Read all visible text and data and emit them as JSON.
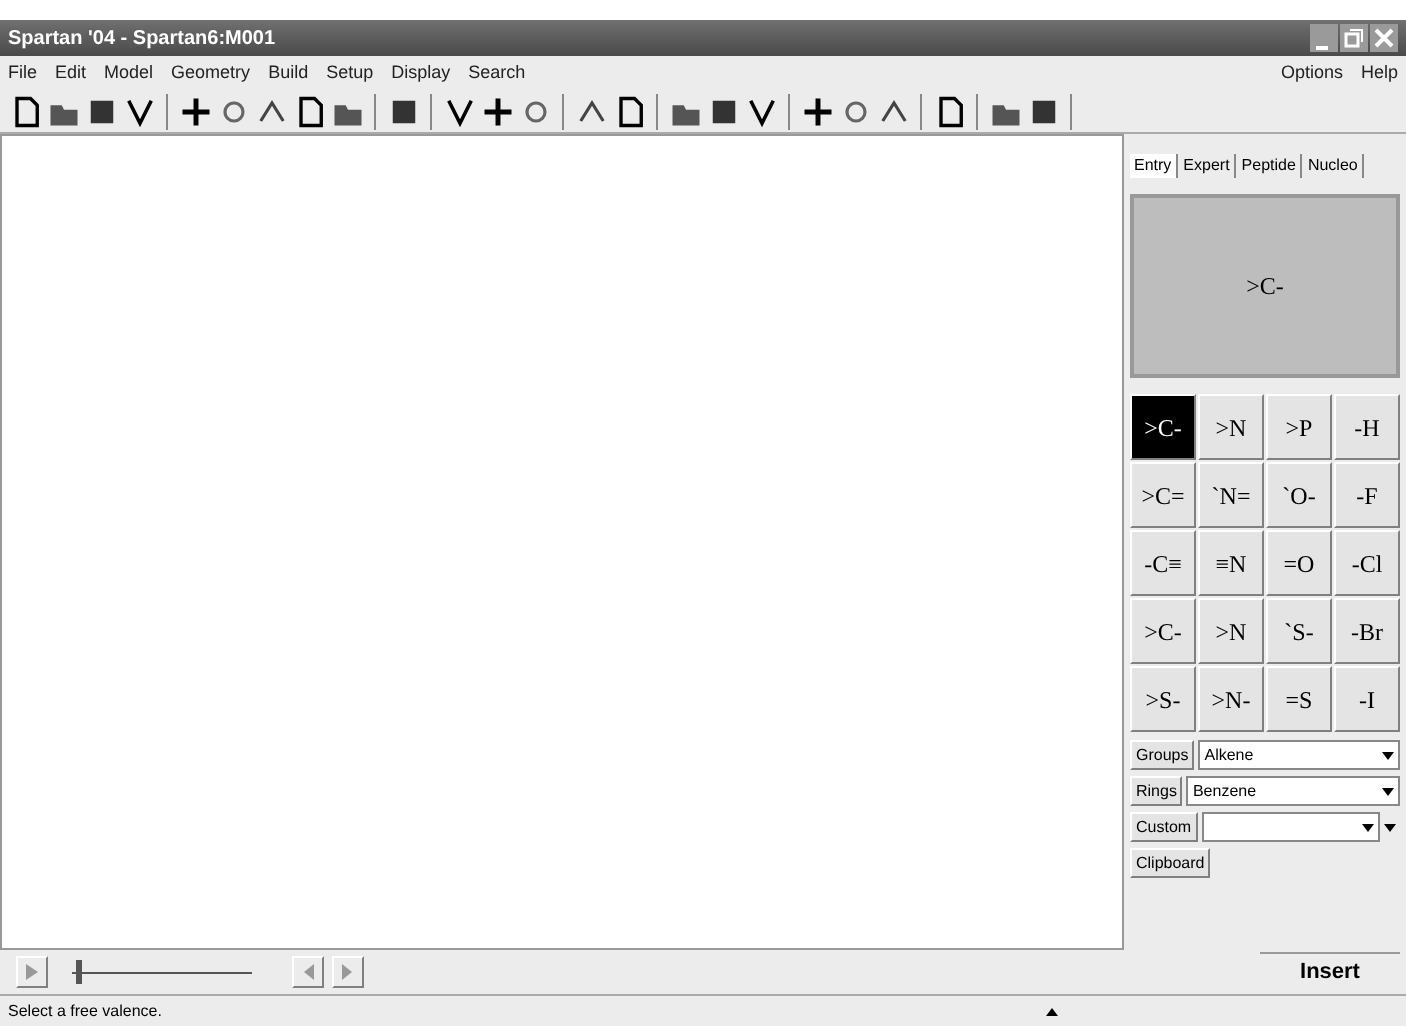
{
  "window": {
    "title": "Spartan '04 - Spartan6:M001"
  },
  "menu": {
    "left": [
      "File",
      "Edit",
      "Model",
      "Geometry",
      "Build",
      "Setup",
      "Display",
      "Search"
    ],
    "right": [
      "Options",
      "Help"
    ]
  },
  "panel": {
    "tabs": [
      {
        "label": "Entry",
        "selected": true
      },
      {
        "label": "Expert",
        "selected": false
      },
      {
        "label": "Peptide",
        "selected": false
      },
      {
        "label": "Nucleo",
        "selected": false
      }
    ],
    "preview": ">C-",
    "fragments": [
      {
        "label": ">C-",
        "selected": true
      },
      {
        "label": ">N",
        "selected": false
      },
      {
        "label": ">P",
        "selected": false
      },
      {
        "label": "-H",
        "selected": false
      },
      {
        "label": ">C=",
        "selected": false
      },
      {
        "label": "`N=",
        "selected": false
      },
      {
        "label": "`O-",
        "selected": false
      },
      {
        "label": "-F",
        "selected": false
      },
      {
        "label": "-C≡",
        "selected": false
      },
      {
        "label": "≡N",
        "selected": false
      },
      {
        "label": "=O",
        "selected": false
      },
      {
        "label": "-Cl",
        "selected": false
      },
      {
        "label": ">C-",
        "selected": false
      },
      {
        "label": ">N",
        "selected": false
      },
      {
        "label": "`S-",
        "selected": false
      },
      {
        "label": "-Br",
        "selected": false
      },
      {
        "label": ">S-",
        "selected": false
      },
      {
        "label": ">N-",
        "selected": false
      },
      {
        "label": "=S",
        "selected": false
      },
      {
        "label": "-I",
        "selected": false
      }
    ],
    "libraries": [
      {
        "kind": "preset",
        "button": "Groups",
        "value": "Alkene"
      },
      {
        "kind": "preset",
        "button": "Rings",
        "value": "Benzene"
      },
      {
        "kind": "custom",
        "button": "Custom"
      }
    ],
    "clipboard": "Clipboard",
    "insert": "Insert"
  },
  "player": {
    "level": 0.02
  },
  "status_bar": {
    "message": "Select a free valence."
  }
}
